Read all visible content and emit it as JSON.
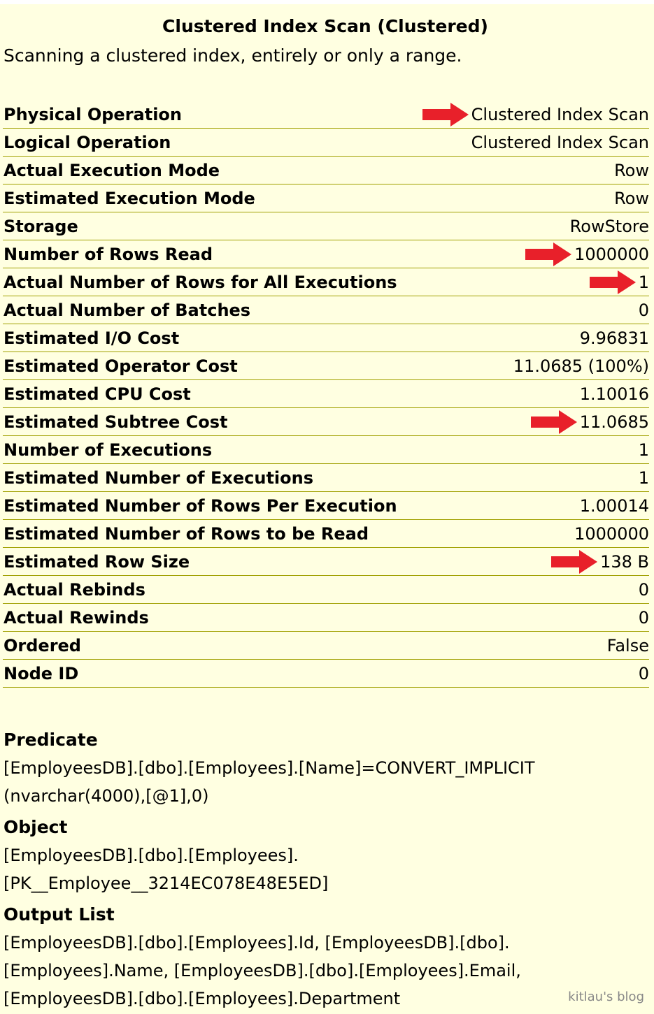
{
  "header": {
    "title": "Clustered Index Scan (Clustered)",
    "description": "Scanning a clustered index, entirely or only a range."
  },
  "properties": [
    {
      "label": "Physical Operation",
      "value": "Clustered Index Scan",
      "highlighted": true
    },
    {
      "label": "Logical Operation",
      "value": "Clustered Index Scan",
      "highlighted": false
    },
    {
      "label": "Actual Execution Mode",
      "value": "Row",
      "highlighted": false
    },
    {
      "label": "Estimated Execution Mode",
      "value": "Row",
      "highlighted": false
    },
    {
      "label": "Storage",
      "value": "RowStore",
      "highlighted": false
    },
    {
      "label": "Number of Rows Read",
      "value": "1000000",
      "highlighted": true
    },
    {
      "label": "Actual Number of Rows for All Executions",
      "value": "1",
      "highlighted": true
    },
    {
      "label": "Actual Number of Batches",
      "value": "0",
      "highlighted": false
    },
    {
      "label": "Estimated I/O Cost",
      "value": "9.96831",
      "highlighted": false
    },
    {
      "label": "Estimated Operator Cost",
      "value": "11.0685 (100%)",
      "highlighted": false
    },
    {
      "label": "Estimated CPU Cost",
      "value": "1.10016",
      "highlighted": false
    },
    {
      "label": "Estimated Subtree Cost",
      "value": "11.0685",
      "highlighted": true
    },
    {
      "label": "Number of Executions",
      "value": "1",
      "highlighted": false
    },
    {
      "label": "Estimated Number of Executions",
      "value": "1",
      "highlighted": false
    },
    {
      "label": "Estimated Number of Rows Per Execution",
      "value": "1.00014",
      "highlighted": false
    },
    {
      "label": "Estimated Number of Rows to be Read",
      "value": "1000000",
      "highlighted": false
    },
    {
      "label": "Estimated Row Size",
      "value": "138 B",
      "highlighted": true
    },
    {
      "label": "Actual Rebinds",
      "value": "0",
      "highlighted": false
    },
    {
      "label": "Actual Rewinds",
      "value": "0",
      "highlighted": false
    },
    {
      "label": "Ordered",
      "value": "False",
      "highlighted": false
    },
    {
      "label": "Node ID",
      "value": "0",
      "highlighted": false
    }
  ],
  "sections": {
    "predicate": {
      "heading": "Predicate",
      "lines": [
        "[EmployeesDB].[dbo].[Employees].[Name]=CONVERT_IMPLICIT",
        "(nvarchar(4000),[@1],0)"
      ]
    },
    "object": {
      "heading": "Object",
      "lines": [
        "[EmployeesDB].[dbo].[Employees].",
        "[PK__Employee__3214EC078E48E5ED]"
      ]
    },
    "output_list": {
      "heading": "Output List",
      "lines": [
        "[EmployeesDB].[dbo].[Employees].Id, [EmployeesDB].[dbo].",
        "[Employees].Name, [EmployeesDB].[dbo].[Employees].Email,",
        "[EmployeesDB].[dbo].[Employees].Department"
      ]
    }
  },
  "watermark": "kitlau's blog",
  "colors": {
    "background": "#ffffe1",
    "divider": "#a0a000",
    "arrow": "#e8202a"
  }
}
